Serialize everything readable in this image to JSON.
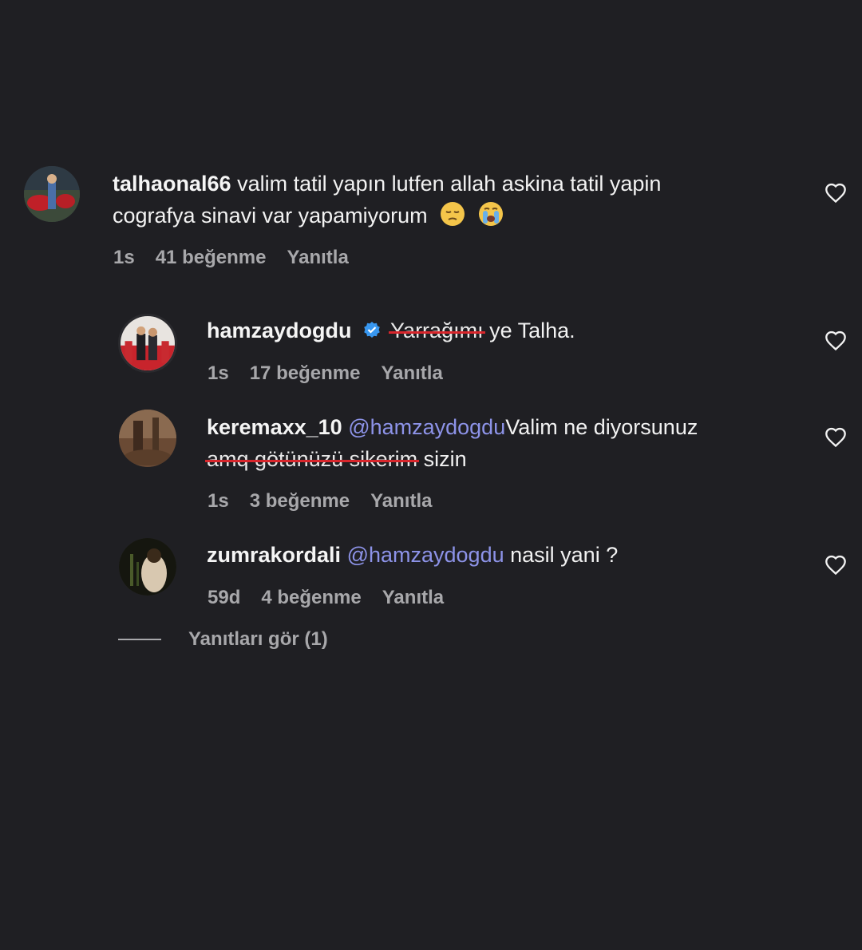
{
  "comments": [
    {
      "username": "talhaonal66",
      "text_line1": "valim tatil yapın lutfen allah askina tatil yapin",
      "text_line2": "cografya sinavi var yapamiyorum",
      "time": "1s",
      "likes": "41 beğenme",
      "reply": "Yanıtla",
      "emojis": [
        "pensive-face-emoji",
        "crying-face-emoji"
      ]
    },
    {
      "username": "hamzaydogdu",
      "verified": true,
      "struck": "Yarrağımı",
      "text": "ye Talha.",
      "time": "1s",
      "likes": "17 beğenme",
      "reply": "Yanıtla"
    },
    {
      "username": "keremaxx_10",
      "mention": "@hamzaydogdu",
      "text": "Valim ne diyorsunuz",
      "struck": "amq götünüzü sikerim",
      "text_end": "sizin",
      "time": "1s",
      "likes": "3 beğenme",
      "reply": "Yanıtla"
    },
    {
      "username": "zumrakordali",
      "mention": "@hamzaydogdu",
      "text": "nasil yani ?",
      "time": "59d",
      "likes": "4 beğenme",
      "reply": "Yanıtla"
    }
  ],
  "view_replies": "Yanıtları gör (1)",
  "colors": {
    "background": "#1f1f23",
    "mention": "#8d93e8",
    "strike": "#d8262c",
    "verified": "#3897f0",
    "meta": "#a8a8ab"
  }
}
